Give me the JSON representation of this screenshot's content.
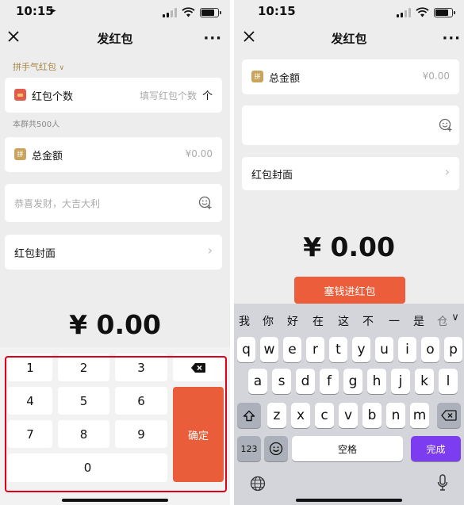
{
  "left": {
    "status_time": "10:15",
    "nav": {
      "title": "发红包",
      "more": "···"
    },
    "lucky_mode": "拼手气红包",
    "packet_count": {
      "icon_color": "#e25b4b",
      "label": "红包个数",
      "placeholder": "填写红包个数",
      "arrow": "个"
    },
    "member_count": "本群共500人",
    "total_amount": {
      "icon_glyph": "拼",
      "icon_color": "#c9a45c",
      "label": "总金额",
      "value": "¥0.00"
    },
    "greeting": {
      "placeholder": "恭喜发财，大吉大利",
      "emoji_icon": "sticker-icon"
    },
    "cover": {
      "label": "红包封面",
      "chevron": "›"
    },
    "amount_display": "¥ 0.00",
    "keypad": {
      "keys": [
        "1",
        "2",
        "3",
        "4",
        "5",
        "6",
        "7",
        "8",
        "9",
        "0"
      ],
      "backspace_icon": "backspace-icon",
      "confirm": "确定"
    }
  },
  "right": {
    "status_time": "10:15",
    "nav": {
      "title": "发红包",
      "more": "···"
    },
    "total_amount": {
      "icon_glyph": "拼",
      "icon_color": "#c9a45c",
      "label": "总金额",
      "value": "¥0.00"
    },
    "greeting": {
      "placeholder": "",
      "emoji_icon": "sticker-icon"
    },
    "cover": {
      "label": "红包封面",
      "chevron": "›"
    },
    "amount_display": "¥ 0.00",
    "stuff_button": "塞钱进红包",
    "keyboard": {
      "candidates": [
        "我",
        "你",
        "好",
        "在",
        "这",
        "不",
        "一",
        "是",
        "仓"
      ],
      "row1": [
        "q",
        "w",
        "e",
        "r",
        "t",
        "y",
        "u",
        "i",
        "o",
        "p"
      ],
      "row2": [
        "a",
        "s",
        "d",
        "f",
        "g",
        "h",
        "j",
        "k",
        "l"
      ],
      "row3": [
        "z",
        "x",
        "c",
        "v",
        "b",
        "n",
        "m"
      ],
      "numbers_key": "123",
      "space": "空格",
      "done": "完成",
      "accent_color": "#7c3df0"
    }
  }
}
